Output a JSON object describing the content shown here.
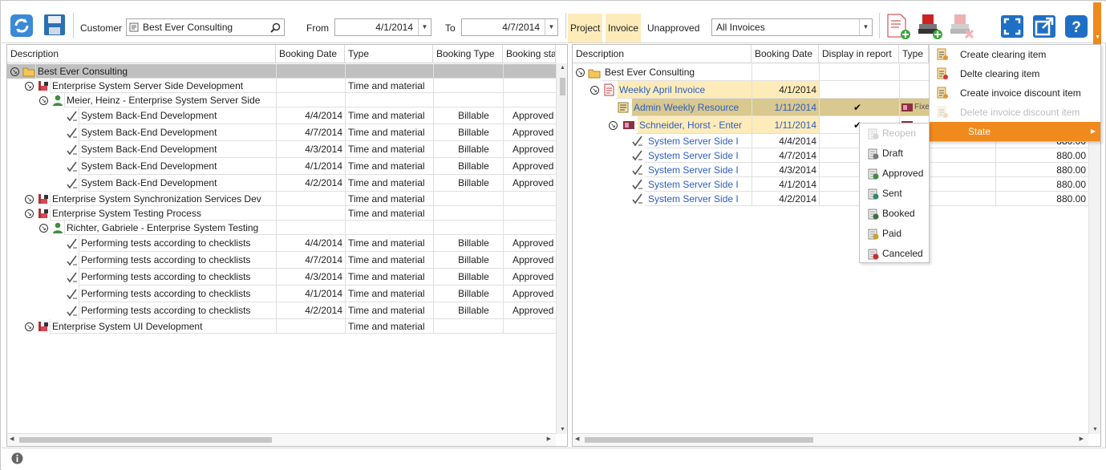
{
  "toolbar": {
    "customer_label": "Customer",
    "customer_value": "Best Ever Consulting",
    "from_label": "From",
    "from_value": "4/1/2014",
    "to_label": "To",
    "to_value": "4/7/2014",
    "filter_project": "Project",
    "filter_invoice": "Invoice",
    "filter_unapproved": "Unapproved",
    "invoice_select": "All Invoices"
  },
  "left": {
    "headers": [
      "Description",
      "Booking Date",
      "Type",
      "Booking Type",
      "Booking sta"
    ],
    "rows": [
      {
        "desc": "Best Ever Consulting",
        "date": "",
        "type": "",
        "btype": "",
        "status": ""
      },
      {
        "desc": "Enterprise System Server Side Development",
        "date": "",
        "type": "Time and material",
        "btype": "",
        "status": ""
      },
      {
        "desc": "Meier, Heinz - Enterprise System Server Side",
        "date": "",
        "type": "",
        "btype": "",
        "status": ""
      },
      {
        "desc": "System Back-End Development",
        "date": "4/4/2014",
        "type": "Time and material",
        "btype": "Billable",
        "status": "Approved"
      },
      {
        "desc": "System Back-End Development",
        "date": "4/7/2014",
        "type": "Time and material",
        "btype": "Billable",
        "status": "Approved"
      },
      {
        "desc": "System Back-End Development",
        "date": "4/3/2014",
        "type": "Time and material",
        "btype": "Billable",
        "status": "Approved"
      },
      {
        "desc": "System Back-End Development",
        "date": "4/1/2014",
        "type": "Time and material",
        "btype": "Billable",
        "status": "Approved"
      },
      {
        "desc": "System Back-End Development",
        "date": "4/2/2014",
        "type": "Time and material",
        "btype": "Billable",
        "status": "Approved"
      },
      {
        "desc": "Enterprise System Synchronization Services Dev",
        "date": "",
        "type": "Time and material",
        "btype": "",
        "status": ""
      },
      {
        "desc": "Enterprise System Testing Process",
        "date": "",
        "type": "Time and material",
        "btype": "",
        "status": ""
      },
      {
        "desc": "Richter, Gabriele - Enterprise System Testing",
        "date": "",
        "type": "",
        "btype": "",
        "status": ""
      },
      {
        "desc": "Performing tests according to checklists",
        "date": "4/4/2014",
        "type": "Time and material",
        "btype": "Billable",
        "status": "Approved"
      },
      {
        "desc": "Performing tests according to checklists",
        "date": "4/7/2014",
        "type": "Time and material",
        "btype": "Billable",
        "status": "Approved"
      },
      {
        "desc": "Performing tests according to checklists",
        "date": "4/3/2014",
        "type": "Time and material",
        "btype": "Billable",
        "status": "Approved"
      },
      {
        "desc": "Performing tests according to checklists",
        "date": "4/1/2014",
        "type": "Time and material",
        "btype": "Billable",
        "status": "Approved"
      },
      {
        "desc": "Performing tests according to checklists",
        "date": "4/2/2014",
        "type": "Time and material",
        "btype": "Billable",
        "status": "Approved"
      },
      {
        "desc": "Enterprise System UI Development",
        "date": "",
        "type": "Time and material",
        "btype": "",
        "status": ""
      }
    ]
  },
  "right": {
    "headers": [
      "Description",
      "Booking Date",
      "Display in report",
      "Type"
    ],
    "rows": [
      {
        "desc": "Best Ever Consulting",
        "date": "",
        "check": false,
        "type": "",
        "amount": ""
      },
      {
        "desc": "Weekly April Invoice",
        "date": "4/1/2014",
        "check": false,
        "type": "",
        "amount": ""
      },
      {
        "desc": "Admin Weekly Resource",
        "date": "1/11/2014",
        "check": true,
        "type": "Fixe",
        "amount": ""
      },
      {
        "desc": "Schneider, Horst - Enter",
        "date": "1/11/2014",
        "check": true,
        "type": "",
        "amount": ""
      },
      {
        "desc": "System Server Side I",
        "date": "4/4/2014",
        "check": false,
        "type": "",
        "amount": "880.00"
      },
      {
        "desc": "System Server Side I",
        "date": "4/7/2014",
        "check": false,
        "type": "",
        "amount": "880.00"
      },
      {
        "desc": "System Server Side I",
        "date": "4/3/2014",
        "check": false,
        "type": "",
        "amount": "880.00"
      },
      {
        "desc": "System Server Side I",
        "date": "4/1/2014",
        "check": false,
        "type": "",
        "amount": "880.00"
      },
      {
        "desc": "System Server Side I",
        "date": "4/2/2014",
        "check": false,
        "type": "",
        "amount": "880.00"
      }
    ]
  },
  "context_menu": {
    "items": [
      "Create clearing item",
      "Delte clearing item",
      "Create invoice discount item",
      "Delete invoice discount item",
      "State"
    ]
  },
  "submenu": {
    "items": [
      "Reopen",
      "Draft",
      "Approved",
      "Sent",
      "Booked",
      "Paid",
      "Canceled"
    ]
  },
  "colors": {
    "accent": "#f08a1c",
    "highlight": "#fdebb9",
    "link": "#2e5fbf"
  }
}
